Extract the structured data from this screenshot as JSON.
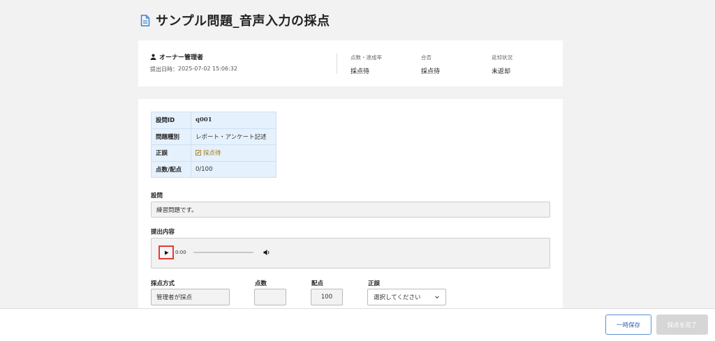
{
  "page": {
    "title": "サンプル問題_音声入力の採点",
    "title_icon": "document-icon"
  },
  "submission": {
    "owner_name": "オーナー管理者",
    "submitted_label": "提出日時：",
    "submitted_at": "2025-07-02 15:06:32",
    "score_label": "点数・達成率",
    "score_value": "採点待",
    "pass_label": "合否",
    "pass_value": "採点待",
    "return_label": "返却状況",
    "return_value": "未返却"
  },
  "meta_table": [
    {
      "key": "設問ID",
      "value": "q001"
    },
    {
      "key": "問題種別",
      "value": "レポート・アンケート記述"
    },
    {
      "key": "正誤",
      "value": "採点待"
    },
    {
      "key": "点数/配点",
      "value": "0/100"
    }
  ],
  "question": {
    "label": "設問",
    "text": "練習問題です。"
  },
  "answer": {
    "label": "提出内容",
    "time": "0:00"
  },
  "grading": {
    "method_label": "採点方式",
    "method_value": "管理者が採点",
    "score_label": "点数",
    "score_value": "",
    "points_label": "配点",
    "points_value": "100",
    "correct_label": "正誤",
    "correct_placeholder": "選択してください"
  },
  "footer": {
    "save_label": "一時保存",
    "complete_label": "採点を完了"
  },
  "colors": {
    "accent": "#3468b8",
    "table_bg": "#e5f1fc",
    "pending": "#a07a20",
    "play_highlight": "#e53935"
  }
}
